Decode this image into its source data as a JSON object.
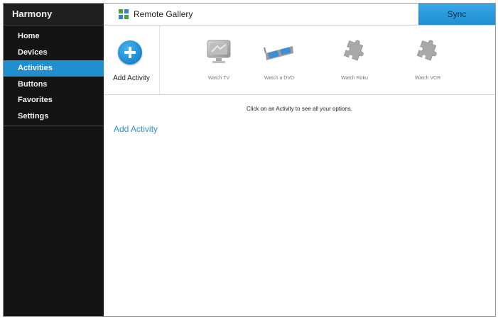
{
  "sidebar": {
    "brand": "Harmony",
    "items": [
      {
        "label": "Home",
        "active": false
      },
      {
        "label": "Devices",
        "active": false
      },
      {
        "label": "Activities",
        "active": true
      },
      {
        "label": "Buttons",
        "active": false
      },
      {
        "label": "Favorites",
        "active": false
      },
      {
        "label": "Settings",
        "active": false
      }
    ]
  },
  "header": {
    "title": "Remote Gallery",
    "icon": "grid-icon",
    "sync_label": "Sync"
  },
  "activities": {
    "add_label": "Add Activity",
    "items": [
      {
        "label": "Watch TV",
        "icon": "tv-icon"
      },
      {
        "label": "Watch a DVD",
        "icon": "3d-glasses-icon"
      },
      {
        "label": "Watch Roku",
        "icon": "puzzle-icon"
      },
      {
        "label": "Watch VCR",
        "icon": "puzzle-icon"
      }
    ]
  },
  "main": {
    "hint": "Click on an Activity to see all your options.",
    "add_link": "Add Activity"
  },
  "colors": {
    "accent": "#1f8fd0",
    "sidebar_bg": "#141414",
    "link": "#2f92d4"
  }
}
